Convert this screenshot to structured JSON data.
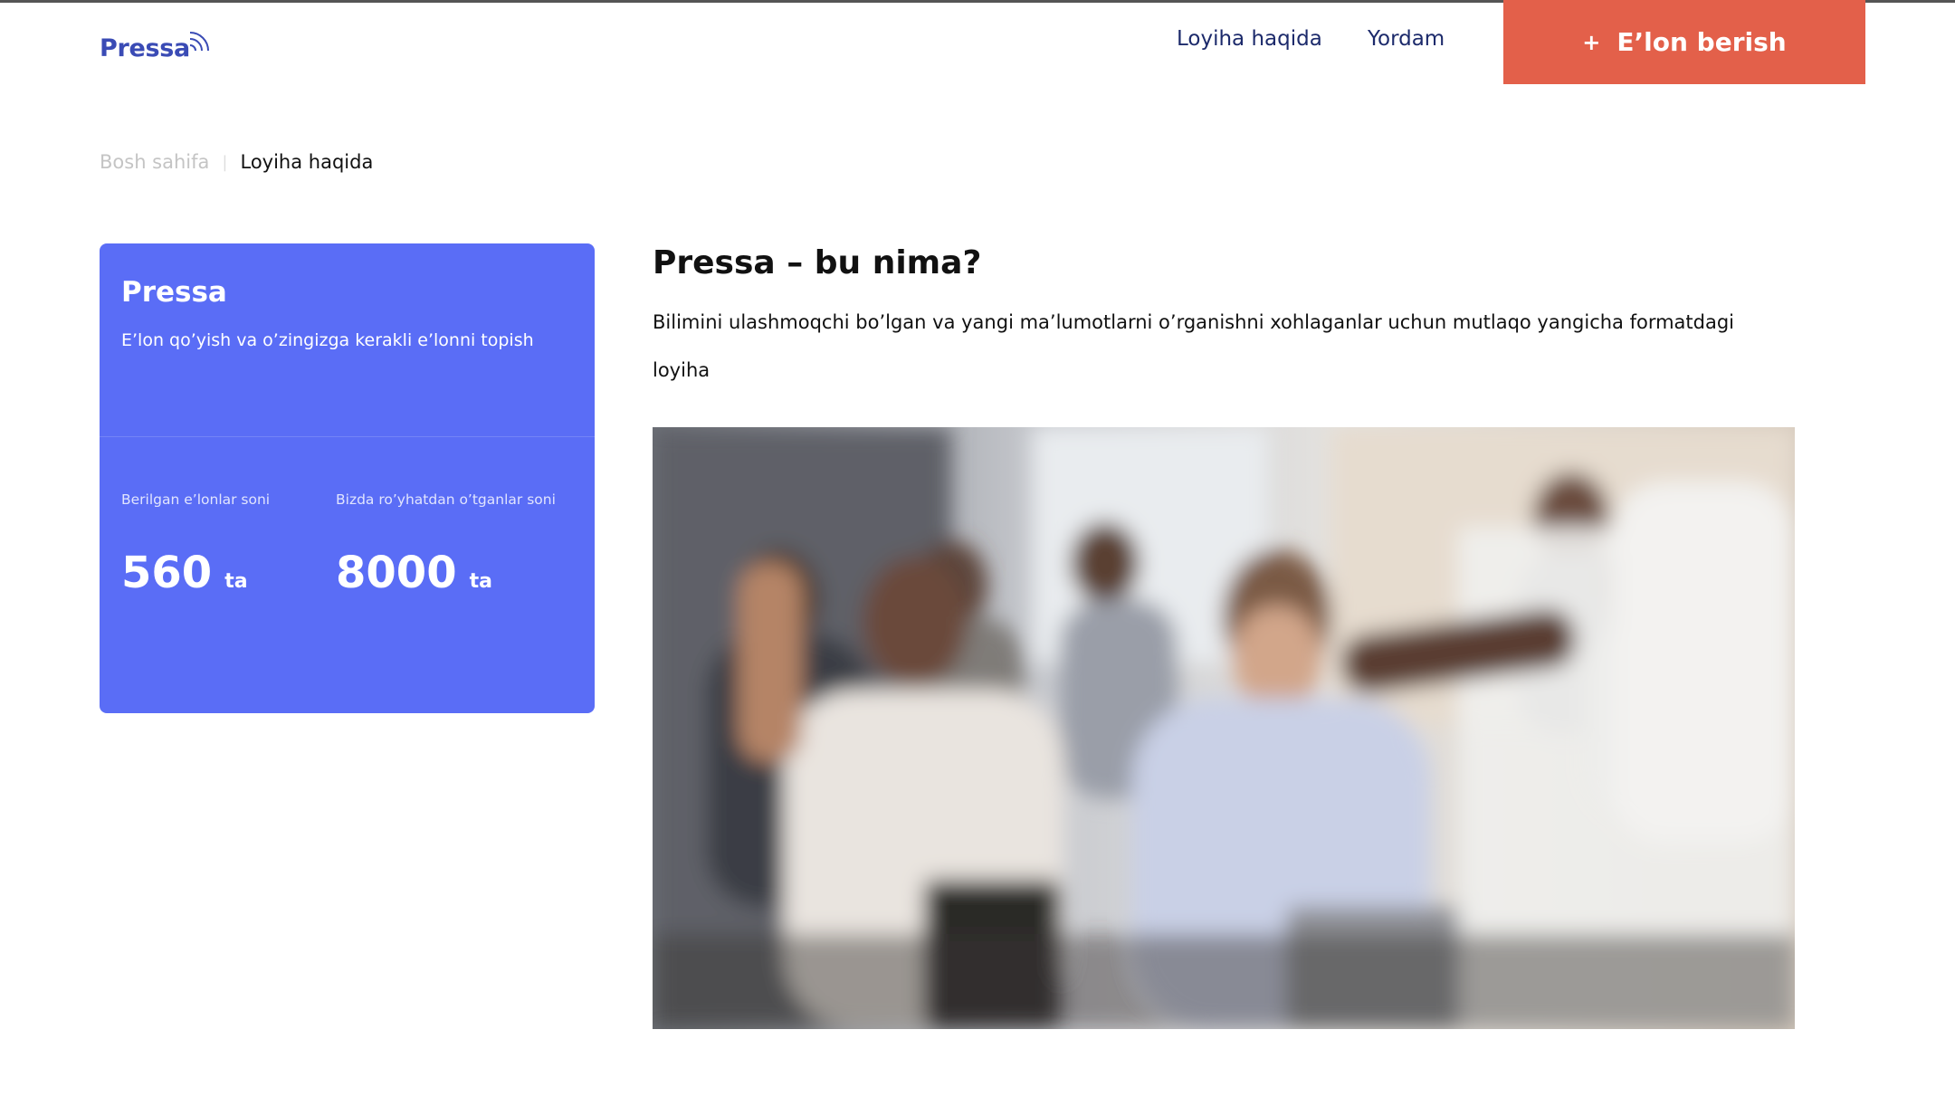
{
  "header": {
    "logo_text": "Pressa",
    "nav": {
      "about": "Loyiha haqida",
      "help": "Yordam"
    },
    "cta": {
      "icon": "+",
      "label": "E’lon berish",
      "color": "#e3604a"
    }
  },
  "breadcrumb": {
    "home": "Bosh sahifa",
    "separator": "|",
    "current": "Loyiha haqida"
  },
  "card": {
    "title": "Pressa",
    "subtitle": "E’lon qo’yish va o’zingizga kerakli e’lonni topish",
    "color": "#5a6df6",
    "stats": [
      {
        "label": "Berilgan e’lonlar soni",
        "value": "560",
        "unit": "ta"
      },
      {
        "label": "Bizda ro’yhatdan o’tganlar soni",
        "value": "8000",
        "unit": "ta"
      }
    ]
  },
  "main": {
    "title": "Pressa – bu nima?",
    "description": "Bilimini ulashmoqchi bo’lgan va yangi ma’lumotlarni o’rganishni xohlaganlar uchun mutlaqo yangicha formatdagi loyiha"
  }
}
